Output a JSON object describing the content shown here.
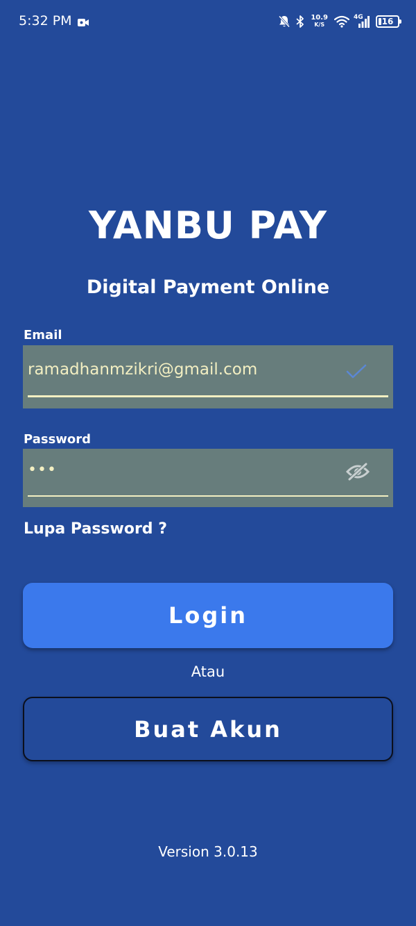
{
  "status_bar": {
    "time": "5:32 PM",
    "net_speed_value": "10.9",
    "net_speed_unit": "K/S",
    "signal_type": "4G",
    "battery_level": "16",
    "icons": [
      "video-recording-icon",
      "notifications-muted-icon",
      "bluetooth-icon",
      "wifi-icon",
      "cell-signal-icon",
      "battery-icon"
    ]
  },
  "header": {
    "title": "YANBU PAY",
    "subtitle": "Digital Payment Online"
  },
  "form": {
    "email": {
      "label": "Email",
      "value": "ramadhanmzikri@gmail.com",
      "icon": "check-icon"
    },
    "password": {
      "label": "Password",
      "value": "•••",
      "icon": "eye-off-icon"
    },
    "forgot_password": "Lupa Password ?"
  },
  "actions": {
    "login_label": "Login",
    "or_label": "Atau",
    "create_account_label": "Buat Akun"
  },
  "footer": {
    "version": "Version 3.0.13"
  },
  "colors": {
    "background": "#234a9a",
    "field_background": "#677d7c",
    "field_text": "#f3efc2",
    "primary_button": "#3b79ec"
  }
}
